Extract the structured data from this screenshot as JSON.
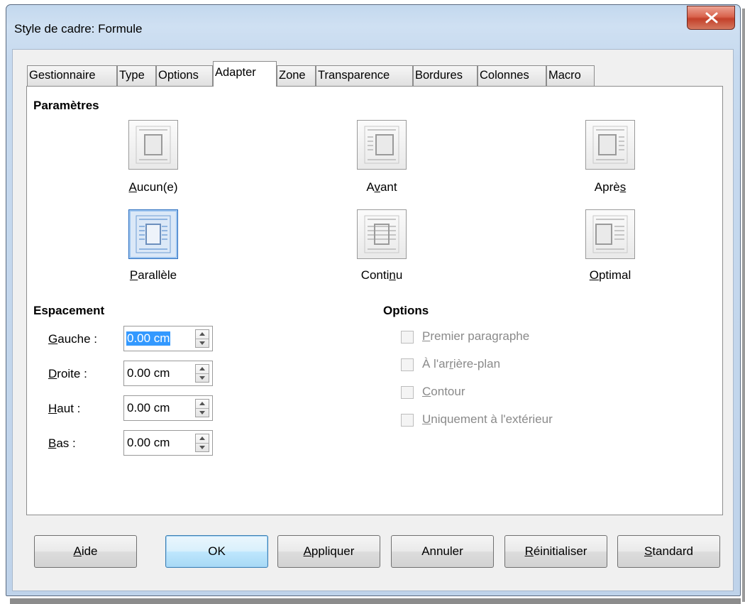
{
  "window": {
    "title": "Style de cadre: Formule"
  },
  "tabs": [
    {
      "label": "Gestionnaire"
    },
    {
      "label": "Type"
    },
    {
      "label": "Options"
    },
    {
      "label": "Adapter"
    },
    {
      "label": "Zone"
    },
    {
      "label": "Transparence"
    },
    {
      "label": "Bordures"
    },
    {
      "label": "Colonnes"
    },
    {
      "label": "Macro"
    }
  ],
  "active_tab": "Adapter",
  "settings": {
    "heading": "Paramètres",
    "wrap_options": [
      {
        "pre": "",
        "key": "A",
        "post": "ucun(e)",
        "icon": "wrap-none-icon",
        "selected": false
      },
      {
        "pre": "A",
        "key": "v",
        "post": "ant",
        "icon": "wrap-before-icon",
        "selected": false
      },
      {
        "pre": "Aprè",
        "key": "s",
        "post": "",
        "icon": "wrap-after-icon",
        "selected": false
      },
      {
        "pre": "",
        "key": "P",
        "post": "arallèle",
        "icon": "wrap-parallel-icon",
        "selected": true
      },
      {
        "pre": "Conti",
        "key": "n",
        "post": "u",
        "icon": "wrap-through-icon",
        "selected": false
      },
      {
        "pre": "",
        "key": "O",
        "post": "ptimal",
        "icon": "wrap-optimal-icon",
        "selected": false
      }
    ]
  },
  "spacing": {
    "heading": "Espacement",
    "fields": [
      {
        "key": "G",
        "post": "auche :",
        "value": "0.00 cm",
        "selected": true
      },
      {
        "key": "D",
        "post": "roite :",
        "value": "0.00 cm",
        "selected": false
      },
      {
        "key": "H",
        "post": "aut :",
        "value": "0.00 cm",
        "selected": false
      },
      {
        "key": "B",
        "post": "as :",
        "value": "0.00 cm",
        "selected": false
      }
    ]
  },
  "options": {
    "heading": "Options",
    "items": [
      {
        "pre": "",
        "key": "P",
        "post": "remier paragraphe",
        "checked": false,
        "enabled": false
      },
      {
        "pre": "À l'ar",
        "key": "r",
        "post": "ière-plan",
        "checked": false,
        "enabled": false
      },
      {
        "pre": "",
        "key": "C",
        "post": "ontour",
        "checked": false,
        "enabled": false
      },
      {
        "pre": "",
        "key": "U",
        "post": "niquement à l'extérieur",
        "checked": false,
        "enabled": false
      }
    ]
  },
  "buttons": [
    {
      "pre": "",
      "key": "A",
      "post": "ide",
      "default": false
    },
    {
      "pre": "OK",
      "key": "",
      "post": "",
      "default": true
    },
    {
      "pre": "",
      "key": "A",
      "post": "ppliquer",
      "default": false
    },
    {
      "pre": "Annuler",
      "key": "",
      "post": "",
      "default": false
    },
    {
      "pre": "",
      "key": "R",
      "post": "éinitialiser",
      "default": false
    },
    {
      "pre": "",
      "key": "S",
      "post": "tandard",
      "default": false
    }
  ]
}
